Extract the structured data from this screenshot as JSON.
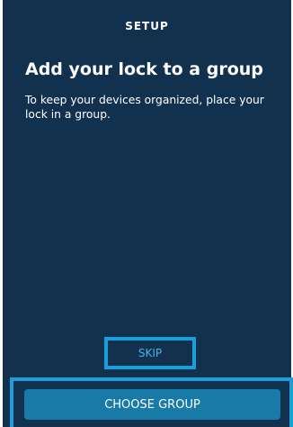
{
  "header": {
    "title": "SETUP"
  },
  "main": {
    "title": "Add your lock to a group",
    "description": "To keep your devices organized, place your lock in a group."
  },
  "actions": {
    "skip_label": "SKIP",
    "choose_group_label": "CHOOSE GROUP"
  },
  "colors": {
    "panel_background": "#11314f",
    "highlight_border": "#1a9fdc",
    "skip_text": "#46b2e8",
    "primary_button": "#177aa7"
  }
}
